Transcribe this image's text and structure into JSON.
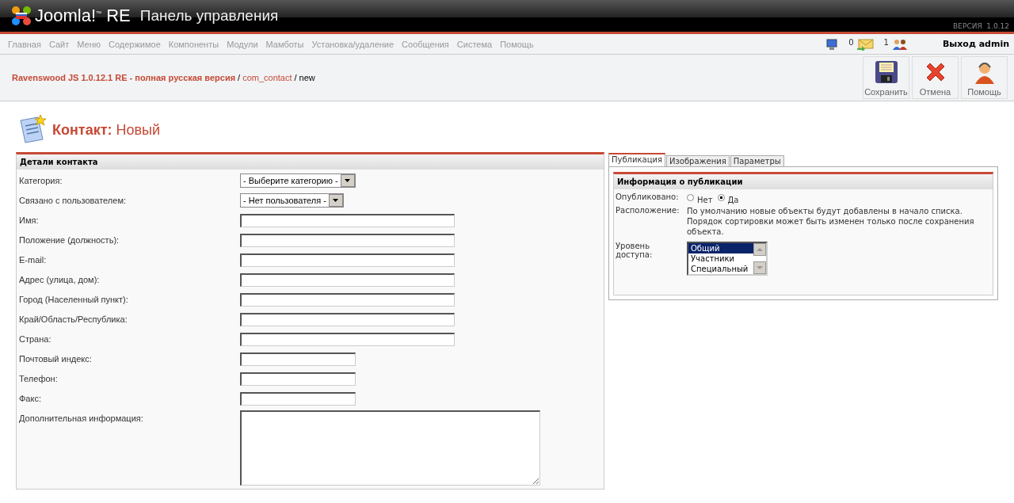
{
  "header": {
    "logo": "Joomla!$^{™}$ RE",
    "title": "Панель управления",
    "version": "ВЕРСИЯ  1.0.12"
  },
  "menu": [
    "Главная",
    "Сайт",
    "Меню",
    "Содержимое",
    "Компоненты",
    "Модули",
    "Мамботы",
    "Установка/удаление",
    "Сообщения",
    "Система",
    "Помощь"
  ],
  "status": {
    "messages": "0",
    "users": "1",
    "logout": "Выход admin"
  },
  "breadcrumb": [
    {
      "text": "Ravenswood JS 1.0.12.1 RE - полная русская версия",
      "kind": "site"
    },
    {
      "text": "/",
      "kind": "separator"
    },
    {
      "text": "com_contact",
      "kind": "link"
    },
    {
      "text": "/",
      "kind": "separator"
    },
    {
      "text": "new",
      "kind": "plain"
    }
  ],
  "toolbar": [
    {
      "label": "Сохранить",
      "kind": "save"
    },
    {
      "label": "Отмена",
      "kind": "cancel"
    },
    {
      "label": "Помощь",
      "kind": "help"
    }
  ],
  "page_title": {
    "main": "Контакт:",
    "sub": "Новый"
  },
  "details": {
    "heading": "Детали контакта",
    "fields": [
      {
        "label": "Категория:",
        "kind": "select",
        "value": "- Выберите категорию -"
      },
      {
        "label": "Связано с пользователем:",
        "kind": "select",
        "value": "- Нет пользователя -"
      },
      {
        "label": "Имя:",
        "kind": "text"
      },
      {
        "label": "Положение (должность):",
        "kind": "text"
      },
      {
        "label": "E-mail:",
        "kind": "text"
      },
      {
        "label": "Адрес (улица, дом):",
        "kind": "text"
      },
      {
        "label": "Город (Населенный пункт):",
        "kind": "text"
      },
      {
        "label": "Край/Область/Республика:",
        "kind": "text"
      },
      {
        "label": "Страна:",
        "kind": "text"
      },
      {
        "label": "Почтовый индекс:",
        "kind": "short"
      },
      {
        "label": "Телефон:",
        "kind": "short"
      },
      {
        "label": "Факс:",
        "kind": "short"
      },
      {
        "label": "Дополнительная информация:",
        "kind": "textarea"
      }
    ]
  },
  "tabs": [
    {
      "label": "Публикация",
      "selected": true
    },
    {
      "label": "Изображения",
      "selected": false
    },
    {
      "label": "Параметры",
      "selected": false
    }
  ],
  "publishing": {
    "heading": "Информация о публикации",
    "published": {
      "label": "Опубликовано:",
      "options": [
        {
          "label": "Нет",
          "selected": false
        },
        {
          "label": "Да",
          "selected": true
        }
      ]
    },
    "ordering": {
      "label": "Расположение:",
      "text": "По умолчанию новые объекты будут добавлены в начало списка. Порядок сортировки может быть изменен только после сохранения объекта."
    },
    "access": {
      "label": "Уровень доступа:",
      "options": [
        {
          "label": "Общий",
          "selected": true
        },
        {
          "label": "Участники",
          "selected": false
        },
        {
          "label": "Специальный",
          "selected": false
        }
      ]
    }
  }
}
